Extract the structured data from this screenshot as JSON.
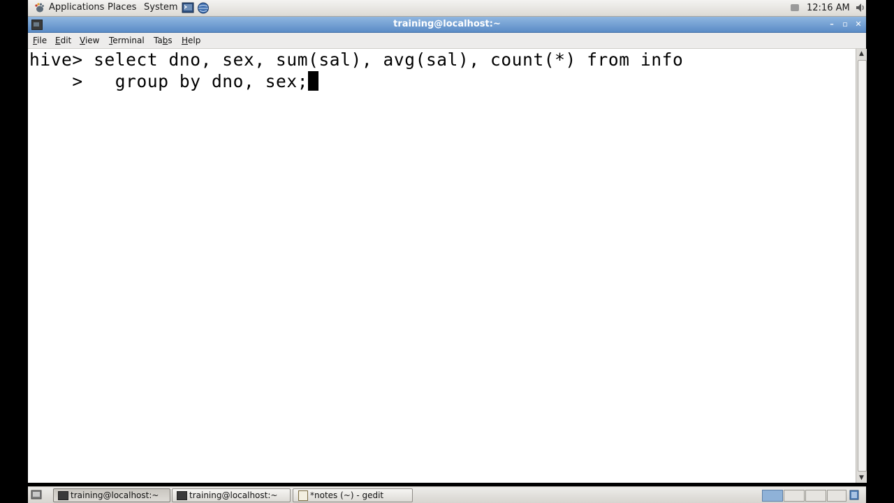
{
  "top_panel": {
    "menus": [
      "Applications",
      "Places",
      "System"
    ],
    "clock": "12:16 AM",
    "icons": [
      "gnome-foot-icon",
      "terminal-launcher-icon",
      "web-browser-launcher-icon",
      "keyboard-indicator-icon",
      "volume-icon"
    ]
  },
  "window": {
    "title": "training@localhost:~",
    "menubar": [
      "File",
      "Edit",
      "View",
      "Terminal",
      "Tabs",
      "Help"
    ],
    "menubar_mnemonics": [
      "F",
      "E",
      "V",
      "T",
      "b",
      "H"
    ]
  },
  "terminal": {
    "lines": [
      "hive> select dno, sex, sum(sal), avg(sal), count(*) from info",
      "    >   group by dno, sex;"
    ]
  },
  "taskbar": {
    "tasks": [
      {
        "label": "training@localhost:~",
        "active": true,
        "icon": "terminal-icon"
      },
      {
        "label": "training@localhost:~",
        "active": false,
        "icon": "terminal-icon"
      },
      {
        "label": "*notes (~) - gedit",
        "active": false,
        "icon": "gedit-icon"
      }
    ],
    "workspaces": 4
  }
}
